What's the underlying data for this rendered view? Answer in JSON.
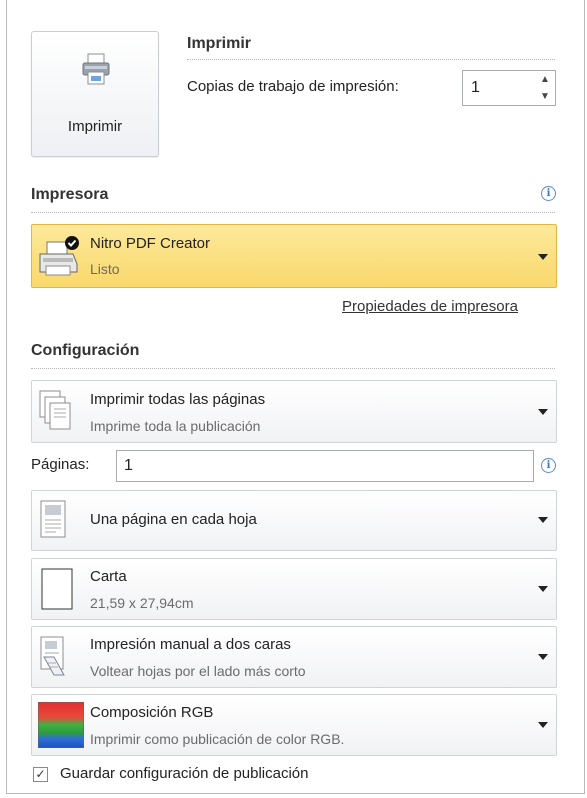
{
  "print": {
    "button_label": "Imprimir",
    "section_title": "Imprimir",
    "copies_label": "Copias de trabajo de impresión:",
    "copies_value": "1"
  },
  "printer": {
    "section_title": "Impresora",
    "name": "Nitro PDF Creator",
    "status": "Listo",
    "properties_link": "Propiedades de impresora"
  },
  "settings": {
    "section_title": "Configuración",
    "range": {
      "title": "Imprimir todas las páginas",
      "subtitle": "Imprime toda la publicación"
    },
    "pages_label": "Páginas:",
    "pages_value": "1",
    "layout": {
      "title": "Una página en cada hoja"
    },
    "paper": {
      "title": "Carta",
      "subtitle": "21,59 x 27,94cm"
    },
    "duplex": {
      "title": "Impresión manual a dos caras",
      "subtitle": "Voltear hojas por el lado más corto"
    },
    "color": {
      "title": "Composición RGB",
      "subtitle": "Imprimir como publicación de color RGB."
    },
    "save_settings_label": "Guardar configuración de publicación",
    "save_settings_checked": true
  },
  "icons": {
    "print": "printer-icon",
    "info": "info-icon",
    "printer_device": "printer-device-icon",
    "pages": "pages-stack-icon",
    "layout": "page-layout-icon",
    "paper": "blank-page-icon",
    "duplex": "duplex-page-icon",
    "color": "rgb-color-icon",
    "dropdown": "chevron-down-icon"
  },
  "colors": {
    "selected_printer_bg": "#f9d86b",
    "info_accent": "#3a74c0"
  }
}
